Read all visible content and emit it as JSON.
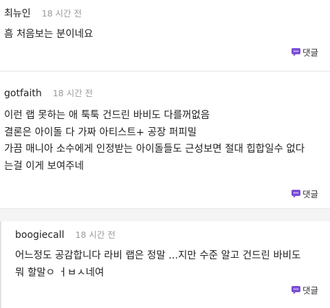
{
  "comments": [
    {
      "author": "최뉴인",
      "time": "18 시간 전",
      "lines": [
        "흠 처음보는 분이네요"
      ],
      "reply_label": "댓글"
    },
    {
      "author": "gotfaith",
      "time": "18 시간 전",
      "lines": [
        "이런 랩 못하는 애 툭툭 건드린 바비도 다를꺼없음",
        "결론은 아이돌 다 가짜 아티스트+ 공장 퍼피밀",
        "가끔 매니아 소수에게 인정받는 아이돌들도 근성보면 절대 힙합일수 없다",
        "는걸 이게 보여주네"
      ],
      "reply_label": "댓글"
    },
    {
      "author": "boogiecall",
      "time": "18 시간 전",
      "lines": [
        "어느정도 공감합니다 라비 랩은 정말 ...지만 수준 알고 건드린 바비도",
        "뭐 할말ㅇ ㅓㅂㅅ네여"
      ],
      "reply_label": "댓글"
    }
  ],
  "colors": {
    "reply_icon": "#7b4fd6",
    "time_text": "#9a9a9a",
    "separator": "#e6e6e6"
  },
  "icons": {
    "reply": "speech-bubble-icon"
  }
}
